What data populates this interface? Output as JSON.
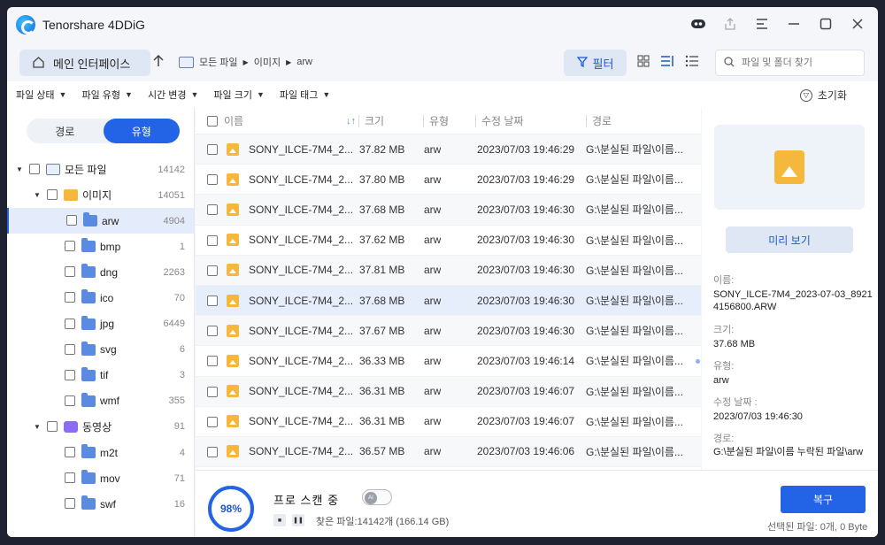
{
  "app": {
    "title": "Tenorshare 4DDiG"
  },
  "window_controls": [
    "bot-icon",
    "share-icon",
    "menu-icon",
    "minimize-icon",
    "maximize-icon",
    "close-icon"
  ],
  "toolbar": {
    "home_label": "메인 인터페이스",
    "breadcrumb": [
      "모든 파일",
      "이미지",
      "arw"
    ],
    "filter_label": "필터",
    "search_placeholder": "파일 및 폴더 찾기"
  },
  "filterbar": {
    "filters": [
      "파일 상태",
      "파일 유형",
      "시간 변경",
      "파일 크기",
      "파일 태그"
    ],
    "reset_label": "초기화"
  },
  "sidebar": {
    "tabs": [
      "경로",
      "유형"
    ],
    "active_tab": "유형",
    "tree": [
      {
        "label": "모든 파일",
        "count": "14142",
        "level": 0,
        "icon": "hdd-icon",
        "expanded": true
      },
      {
        "label": "이미지",
        "count": "14051",
        "level": 1,
        "icon": "image-icon",
        "expanded": true
      },
      {
        "label": "arw",
        "count": "4904",
        "level": 2,
        "icon": "folder-icon",
        "selected": true
      },
      {
        "label": "bmp",
        "count": "1",
        "level": 2,
        "icon": "folder-icon"
      },
      {
        "label": "dng",
        "count": "2263",
        "level": 2,
        "icon": "folder-icon"
      },
      {
        "label": "ico",
        "count": "70",
        "level": 2,
        "icon": "folder-icon"
      },
      {
        "label": "jpg",
        "count": "6449",
        "level": 2,
        "icon": "folder-icon"
      },
      {
        "label": "svg",
        "count": "6",
        "level": 2,
        "icon": "folder-icon"
      },
      {
        "label": "tif",
        "count": "3",
        "level": 2,
        "icon": "folder-icon"
      },
      {
        "label": "wmf",
        "count": "355",
        "level": 2,
        "icon": "folder-icon"
      },
      {
        "label": "동영상",
        "count": "91",
        "level": 1,
        "icon": "video-icon",
        "expanded": true
      },
      {
        "label": "m2t",
        "count": "4",
        "level": 2,
        "icon": "folder-icon"
      },
      {
        "label": "mov",
        "count": "71",
        "level": 2,
        "icon": "folder-icon"
      },
      {
        "label": "swf",
        "count": "16",
        "level": 2,
        "icon": "folder-icon"
      }
    ]
  },
  "filelist": {
    "columns": [
      "이름",
      "크기",
      "유형",
      "수정 날짜",
      "경로"
    ],
    "rows": [
      {
        "name": "SONY_ILCE-7M4_2...",
        "size": "37.82 MB",
        "type": "arw",
        "date": "2023/07/03 19:46:29",
        "path": "G:\\분실된 파일\\이름..."
      },
      {
        "name": "SONY_ILCE-7M4_2...",
        "size": "37.80 MB",
        "type": "arw",
        "date": "2023/07/03 19:46:29",
        "path": "G:\\분실된 파일\\이름..."
      },
      {
        "name": "SONY_ILCE-7M4_2...",
        "size": "37.68 MB",
        "type": "arw",
        "date": "2023/07/03 19:46:30",
        "path": "G:\\분실된 파일\\이름..."
      },
      {
        "name": "SONY_ILCE-7M4_2...",
        "size": "37.62 MB",
        "type": "arw",
        "date": "2023/07/03 19:46:30",
        "path": "G:\\분실된 파일\\이름..."
      },
      {
        "name": "SONY_ILCE-7M4_2...",
        "size": "37.81 MB",
        "type": "arw",
        "date": "2023/07/03 19:46:30",
        "path": "G:\\분실된 파일\\이름..."
      },
      {
        "name": "SONY_ILCE-7M4_2...",
        "size": "37.68 MB",
        "type": "arw",
        "date": "2023/07/03 19:46:30",
        "path": "G:\\분실된 파일\\이름...",
        "highlighted": true
      },
      {
        "name": "SONY_ILCE-7M4_2...",
        "size": "37.67 MB",
        "type": "arw",
        "date": "2023/07/03 19:46:30",
        "path": "G:\\분실된 파일\\이름..."
      },
      {
        "name": "SONY_ILCE-7M4_2...",
        "size": "36.33 MB",
        "type": "arw",
        "date": "2023/07/03 19:46:14",
        "path": "G:\\분실된 파일\\이름..."
      },
      {
        "name": "SONY_ILCE-7M4_2...",
        "size": "36.31 MB",
        "type": "arw",
        "date": "2023/07/03 19:46:07",
        "path": "G:\\분실된 파일\\이름..."
      },
      {
        "name": "SONY_ILCE-7M4_2...",
        "size": "36.31 MB",
        "type": "arw",
        "date": "2023/07/03 19:46:07",
        "path": "G:\\분실된 파일\\이름..."
      },
      {
        "name": "SONY_ILCE-7M4_2...",
        "size": "36.57 MB",
        "type": "arw",
        "date": "2023/07/03 19:46:06",
        "path": "G:\\분실된 파일\\이름..."
      }
    ]
  },
  "preview": {
    "button_label": "미리 보기",
    "name_label": "이름:",
    "name_value": "SONY_ILCE-7M4_2023-07-03_89214156800.ARW",
    "size_label": "크기:",
    "size_value": "37.68 MB",
    "type_label": "유형:",
    "type_value": "arw",
    "date_label": "수정 날짜 :",
    "date_value": "2023/07/03 19:46:30",
    "path_label": "경로:",
    "path_value": "G:\\분실된 파일\\이름 누락된 파일\\arw"
  },
  "bottombar": {
    "progress": 98,
    "progress_text": "98%",
    "scan_title": "프로 스캔 중",
    "found_text": "찾은 파일:14142개 (166.14 GB)",
    "recover_label": "복구",
    "selected_text": "선택된 파일: 0개, 0 Byte"
  },
  "colors": {
    "accent": "#2264e5",
    "progress_track": "#d9e4fb"
  }
}
